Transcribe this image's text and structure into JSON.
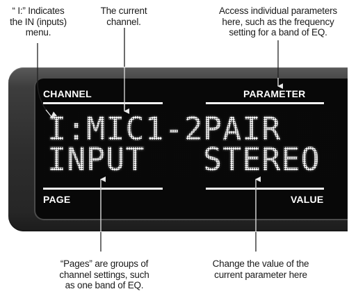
{
  "callouts": {
    "in_indicator": "“ I:” Indicates\nthe IN (inputs)\nmenu.",
    "current_channel": "The current\nchannel.",
    "parameter": "Access individual parameters\nhere, such as the frequency\nsetting for a band of EQ.",
    "pages": "“Pages” are groups of\nchannel settings, such\nas one band of EQ.",
    "value": "Change the value of the\ncurrent parameter here"
  },
  "panel": {
    "label_channel": "CHANNEL",
    "label_parameter": "PARAMETER",
    "label_page": "PAGE",
    "label_value": "VALUE"
  },
  "lcd": {
    "channel": "I:MIC1-2",
    "parameter": "PAIR",
    "page": "INPUT",
    "value": "STEREO"
  }
}
